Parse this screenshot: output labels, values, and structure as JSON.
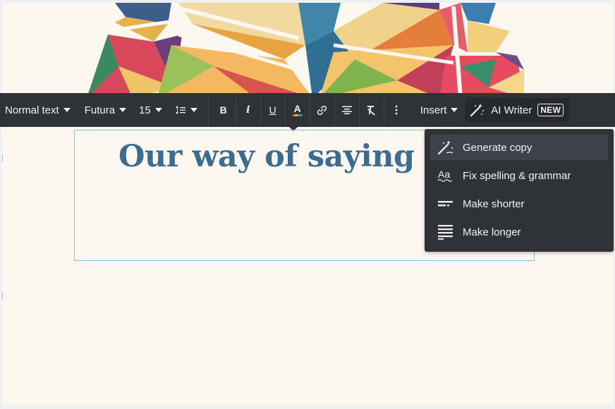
{
  "toolbar": {
    "text_style": "Normal text",
    "font": "Futura",
    "font_size": "15",
    "line_spacing_icon": "line-spacing-icon",
    "bold_label": "B",
    "italic_label": "i",
    "underline_label": "U",
    "text_color_label": "A",
    "link_icon": "link-icon",
    "align_icon": "align-center-icon",
    "clear_format_icon": "clear-format-icon",
    "more_icon": "more-vertical-icon",
    "insert_label": "Insert",
    "ai_writer_label": "AI Writer",
    "new_badge": "NEW"
  },
  "content": {
    "heading": "Our way of saying thanks"
  },
  "ai_menu": {
    "items": [
      {
        "label": "Generate copy",
        "icon": "magic-wand-icon",
        "active": true
      },
      {
        "label": "Fix spelling & grammar",
        "icon": "spellcheck-icon",
        "active": false
      },
      {
        "label": "Make shorter",
        "icon": "shorten-icon",
        "active": false
      },
      {
        "label": "Make longer",
        "icon": "lengthen-icon",
        "active": false
      }
    ]
  },
  "colors": {
    "toolbar_bg": "#2f3237",
    "canvas_bg": "#fcf8ef",
    "heading": "#3a6d8f",
    "selection_border": "#8fbfdc"
  }
}
